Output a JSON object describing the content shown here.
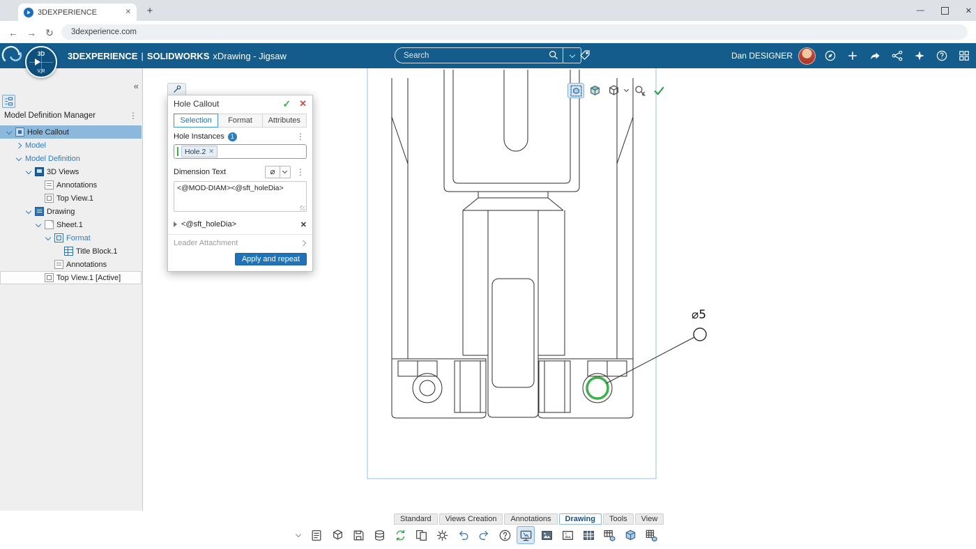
{
  "browser": {
    "tab_title": "3DEXPERIENCE",
    "url": "3dexperience.com",
    "close_tab_glyph": "✕",
    "new_tab_glyph": "+",
    "back_glyph": "←",
    "forward_glyph": "→",
    "reload_glyph": "↻",
    "minimize_glyph": "—",
    "close_glyph": "✕"
  },
  "header": {
    "brand": "3DEXPERIENCE",
    "separator": "|",
    "app_name": "SOLIDWORKS",
    "app_suffix": "xDrawing - Jigsaw",
    "search_placeholder": "Search",
    "user_name": "Dan DESIGNER",
    "compass_top_label": "3D",
    "compass_bottom_label": "V,R",
    "icons": [
      "compass-icon",
      "add-icon",
      "share-icon",
      "share-network-icon",
      "widgets-icon",
      "help-icon",
      "app-grid-icon",
      "tag-icon",
      "search-icon",
      "avatar"
    ]
  },
  "sidebar": {
    "collapse_glyph": "«",
    "kebab_glyph": "⋮",
    "title": "Model Definition Manager",
    "tree": [
      {
        "label": "Hole Callout",
        "indent": 0,
        "chevron": "down",
        "icon": "assembly",
        "selected": true
      },
      {
        "label": "Model",
        "indent": 1,
        "chevron": "right",
        "link": true
      },
      {
        "label": "Model Definition",
        "indent": 1,
        "chevron": "down",
        "link": true
      },
      {
        "label": "3D Views",
        "indent": 2,
        "chevron": "down",
        "icon": "views"
      },
      {
        "label": "Annotations",
        "indent": 3,
        "icon": "annotations"
      },
      {
        "label": "Top View.1",
        "indent": 3,
        "icon": "view"
      },
      {
        "label": "Drawing",
        "indent": 2,
        "chevron": "down",
        "icon": "drawing"
      },
      {
        "label": "Sheet.1",
        "indent": 3,
        "chevron": "down",
        "icon": "sheet"
      },
      {
        "label": "Format",
        "indent": 4,
        "chevron": "down",
        "icon": "format",
        "link": true
      },
      {
        "label": "Title Block.1",
        "indent": 5,
        "icon": "titleblock"
      },
      {
        "label": "Annotations",
        "indent": 4,
        "icon": "annotations"
      },
      {
        "label": "Top View.1 [Active]",
        "indent": 3,
        "icon": "view",
        "active_row": true
      }
    ]
  },
  "dialog": {
    "title": "Hole Callout",
    "ok_glyph": "✓",
    "close_glyph": "✕",
    "kebab_glyph": "⋮",
    "tabs": [
      {
        "label": "Selection",
        "active": true
      },
      {
        "label": "Format",
        "active": false
      },
      {
        "label": "Attributes",
        "active": false
      }
    ],
    "hole_instances_label": "Hole Instances",
    "hole_instances_count": "1",
    "chip_label": "Hole.2",
    "chip_remove_glyph": "✕",
    "dimension_text_label": "Dimension Text",
    "diameter_symbol": "⌀",
    "dimension_text_value": "<@MOD-DIAM><@sft_holeDia>",
    "variable_row_label": "<@sft_holeDia>",
    "variable_remove_glyph": "✕",
    "leader_attachment_label": "Leader Attachment",
    "apply_button_label": "Apply and repeat"
  },
  "canvas": {
    "hole_callout_text": "⌀5",
    "selected_hole_color": "#3fae49",
    "sheet_border_color": "#8fc0e4",
    "toolbar_icons": [
      {
        "name": "edit-view-icon",
        "kind": "editview",
        "selected": true
      },
      {
        "name": "model-cube-icon",
        "kind": "cubecolor"
      },
      {
        "name": "display-style-icon",
        "kind": "cube",
        "has_chevron": true
      },
      {
        "name": "explore-key-icon",
        "kind": "key"
      },
      {
        "name": "accept-icon",
        "kind": "check"
      }
    ]
  },
  "bottom_bar": {
    "tabs": [
      {
        "label": "Standard",
        "active": false
      },
      {
        "label": "Views Creation",
        "active": false
      },
      {
        "label": "Annotations",
        "active": false
      },
      {
        "label": "Drawing",
        "active": true
      },
      {
        "label": "Tools",
        "active": false
      },
      {
        "label": "View",
        "active": false
      }
    ],
    "icons": [
      {
        "name": "new-sheet-icon",
        "kind": "newsheet"
      },
      {
        "name": "projected-view-icon",
        "kind": "cube"
      },
      {
        "name": "save-icon",
        "kind": "save"
      },
      {
        "name": "save-to-platform-icon",
        "kind": "db"
      },
      {
        "name": "update-views-icon",
        "kind": "sync"
      },
      {
        "name": "replace-sheet-icon",
        "kind": "sheets"
      },
      {
        "name": "options-icon",
        "kind": "gear"
      },
      {
        "name": "undo-icon",
        "kind": "undo"
      },
      {
        "name": "redo-icon",
        "kind": "redo"
      },
      {
        "name": "help-icon",
        "kind": "help"
      },
      {
        "name": "capture-icon",
        "kind": "capture",
        "active": true
      },
      {
        "name": "insert-image-icon",
        "kind": "image"
      },
      {
        "name": "image-frame-icon",
        "kind": "image2"
      },
      {
        "name": "insert-table-icon",
        "kind": "table"
      },
      {
        "name": "bom-table-icon",
        "kind": "tablecube"
      },
      {
        "name": "view-3d-icon",
        "kind": "cube3d"
      },
      {
        "name": "grid-3d-icon",
        "kind": "grid3d"
      }
    ]
  },
  "colors": {
    "appbar_bg": "#145c8c",
    "selected_row_bg": "#8cb8db",
    "accent_blue": "#2d7dc1",
    "apply_button_bg": "#2173b8",
    "ok_green": "#3fae49",
    "cancel_red": "#e04438"
  }
}
